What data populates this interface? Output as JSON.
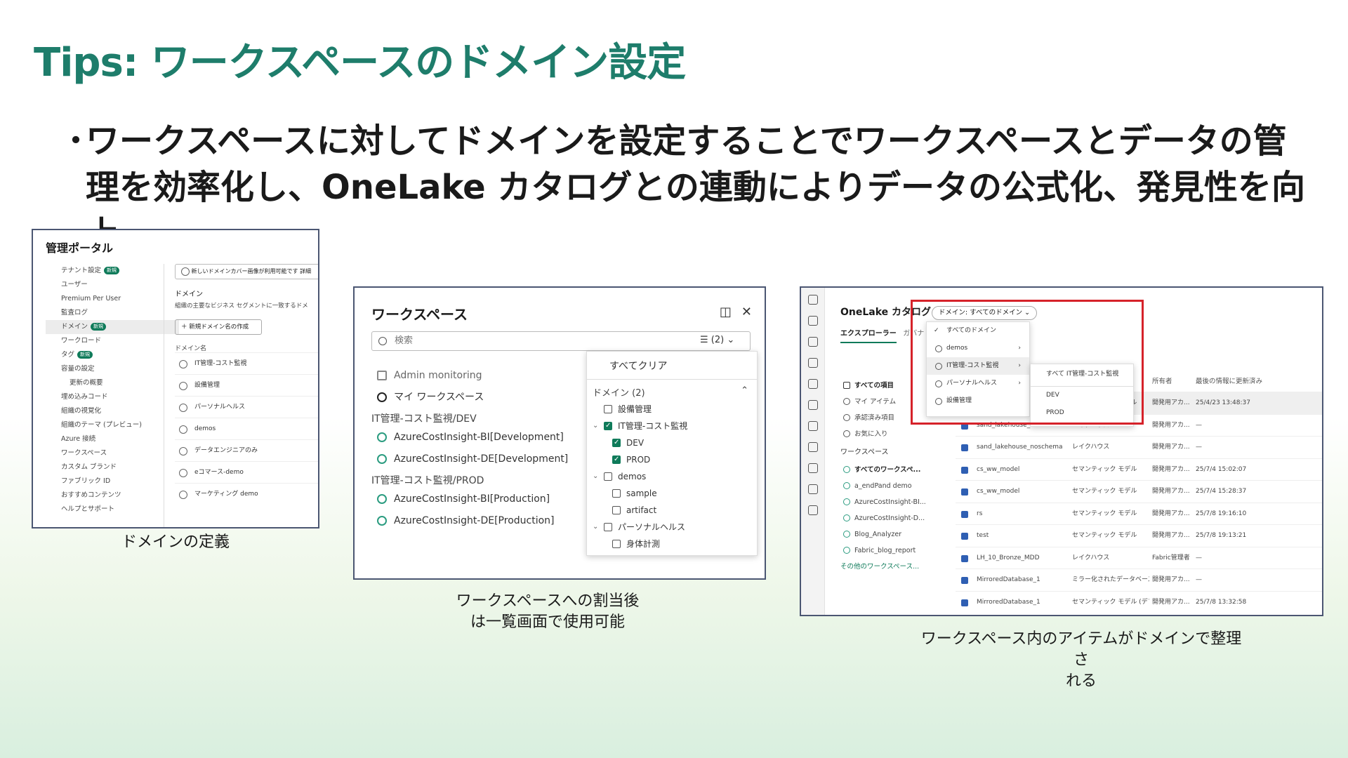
{
  "slide": {
    "title": "Tips: ワークスペースのドメイン設定",
    "bullet_dot": "・",
    "bullet": "ワークスペースに対してドメインを設定することでワークスペースとデータの管理を効率化し、OneLake カタログとの連動によりデータの公式化、発見性を向上"
  },
  "panel1": {
    "title": "管理ポータル",
    "nav": [
      {
        "label": "テナント設定",
        "badge": "新規"
      },
      {
        "label": "ユーザー"
      },
      {
        "label": "Premium Per User"
      },
      {
        "label": "監査ログ"
      },
      {
        "label": "ドメイン",
        "badge": "新規",
        "selected": true
      },
      {
        "label": "ワークロード"
      },
      {
        "label": "タグ",
        "badge": "新規"
      },
      {
        "label": "容量の設定"
      },
      {
        "label": "更新の概要",
        "sub": true
      },
      {
        "label": "埋め込みコード"
      },
      {
        "label": "組織の視覚化"
      },
      {
        "label": "組織のテーマ (プレビュー)"
      },
      {
        "label": "Azure 接続"
      },
      {
        "label": "ワークスペース"
      },
      {
        "label": "カスタム ブランド"
      },
      {
        "label": "ファブリック ID"
      },
      {
        "label": "おすすめコンテンツ"
      },
      {
        "label": "ヘルプとサポート"
      }
    ],
    "notice": "新しいドメインカバー画像が利用可能です 詳細",
    "domain_heading": "ドメイン",
    "domain_desc": "組織の主要なビジネス セグメントに一致するドメ",
    "new_button": "＋ 新規ドメイン名の作成",
    "list_heading": "ドメイン名",
    "domains": [
      "IT管理-コスト監視",
      "設備管理",
      "パーソナルヘルス",
      "demos",
      "データエンジニアのみ",
      "eコマース-demo",
      "マーケティング demo"
    ]
  },
  "panel2": {
    "title": "ワークスペース",
    "search_placeholder": "検索",
    "filter_label": "(2)",
    "rows_top": [
      {
        "label": "Admin monitoring"
      },
      {
        "label": "マイ ワークスペース"
      }
    ],
    "group1": "IT管理-コスト監視/DEV",
    "group1_items": [
      "AzureCostInsight-BI[Development]",
      "AzureCostInsight-DE[Development]"
    ],
    "group2": "IT管理-コスト監視/PROD",
    "group2_items": [
      "AzureCostInsight-BI[Production]",
      "AzureCostInsight-DE[Production]"
    ],
    "dropdown": {
      "clear": "すべてクリア",
      "heading": "ドメイン (2)",
      "items": [
        {
          "label": "設備管理",
          "checked": false,
          "level": 0
        },
        {
          "label": "IT管理-コスト監視",
          "checked": true,
          "level": 0,
          "expanded": true
        },
        {
          "label": "DEV",
          "checked": true,
          "level": 1
        },
        {
          "label": "PROD",
          "checked": true,
          "level": 1
        },
        {
          "label": "demos",
          "checked": false,
          "level": 0,
          "expanded": true
        },
        {
          "label": "sample",
          "checked": false,
          "level": 1
        },
        {
          "label": "artifact",
          "checked": false,
          "level": 1
        },
        {
          "label": "パーソナルヘルス",
          "checked": false,
          "level": 0,
          "expanded": true
        },
        {
          "label": "身体計測",
          "checked": false,
          "level": 1
        }
      ]
    }
  },
  "panel3": {
    "title": "OneLake カタログ",
    "domain_pill": "ドメイン: すべてのドメイン ⌄",
    "tab_explorer": "エクスプローラー",
    "tab_2": "ガバナ",
    "menu": [
      "すべてのドメイン",
      "demos",
      "IT管理-コスト監視",
      "パーソナルヘルス",
      "設備管理"
    ],
    "submenu": [
      "すべて IT管理-コスト監視",
      "DEV",
      "PROD"
    ],
    "left_nav": [
      "すべての項目",
      "マイ アイテム",
      "承認済み項目",
      "お気に入り"
    ],
    "ws_heading": "ワークスペース",
    "ws_items": [
      "すべてのワークスペ...",
      "a_endPand demo",
      "AzureCostInsight-BI...",
      "AzureCostInsight-D...",
      "Blog_Analyzer",
      "Fabric_blog_report"
    ],
    "ws_more": "その他のワークスペース...",
    "columns": [
      "所有者",
      "最後の情報に更新済み"
    ],
    "rows": [
      {
        "name": "",
        "type": "セマンティック モデル",
        "owner": "開発用アカ...",
        "date": "25/4/23 13:48:37"
      },
      {
        "name": "sand_lakehouse_schema",
        "type": "レイクハウス",
        "owner": "開発用アカ...",
        "date": "—"
      },
      {
        "name": "sand_lakehouse_noschema",
        "type": "レイクハウス",
        "owner": "開発用アカ...",
        "date": "—"
      },
      {
        "name": "cs_ww_model",
        "type": "セマンティック モデル",
        "owner": "開発用アカ...",
        "date": "25/7/4 15:02:07"
      },
      {
        "name": "cs_ww_model",
        "type": "セマンティック モデル",
        "owner": "開発用アカ...",
        "date": "25/7/4 15:28:37"
      },
      {
        "name": "rs",
        "type": "セマンティック モデル",
        "owner": "開発用アカ...",
        "date": "25/7/8 19:16:10"
      },
      {
        "name": "test",
        "type": "セマンティック モデル",
        "owner": "開発用アカ...",
        "date": "25/7/8 19:13:21"
      },
      {
        "name": "LH_10_Bronze_MDD",
        "type": "レイクハウス",
        "owner": "Fabric管理者",
        "date": "—"
      },
      {
        "name": "MirroredDatabase_1",
        "type": "ミラー化されたデータベース",
        "owner": "開発用アカ...",
        "date": "—"
      },
      {
        "name": "MirroredDatabase_1",
        "type": "セマンティック モデル (デフ...",
        "owner": "開発用アカ...",
        "date": "25/7/8 13:32:58"
      }
    ]
  },
  "captions": {
    "c1": "ドメインの定義",
    "c2a": "ワークスペースへの割当後",
    "c2b": "は一覧画面で使用可能",
    "c3a": "ワークスペース内のアイテムがドメインで整理さ",
    "c3b": "れる"
  },
  "colors": {
    "title": "#1e7d6b",
    "accent": "#0f7b5a",
    "highlight_box": "#d6222a"
  }
}
